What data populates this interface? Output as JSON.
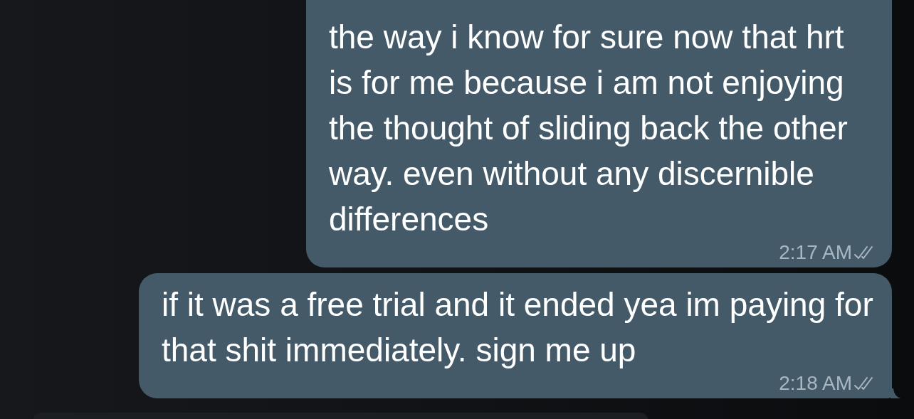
{
  "messages": [
    {
      "kind": "outgoing",
      "text": "the way i know for sure now that hrt is for me because i am not enjoying the thought of sliding back the other way. even without any discernible differences",
      "time": "2:17 AM",
      "read": true,
      "tail": false
    },
    {
      "kind": "outgoing",
      "text": "if it was a free trial and it ended yea im paying for that shit immediately. sign me up",
      "time": "2:18 AM",
      "read": true,
      "tail": true
    },
    {
      "kind": "incoming"
    }
  ]
}
